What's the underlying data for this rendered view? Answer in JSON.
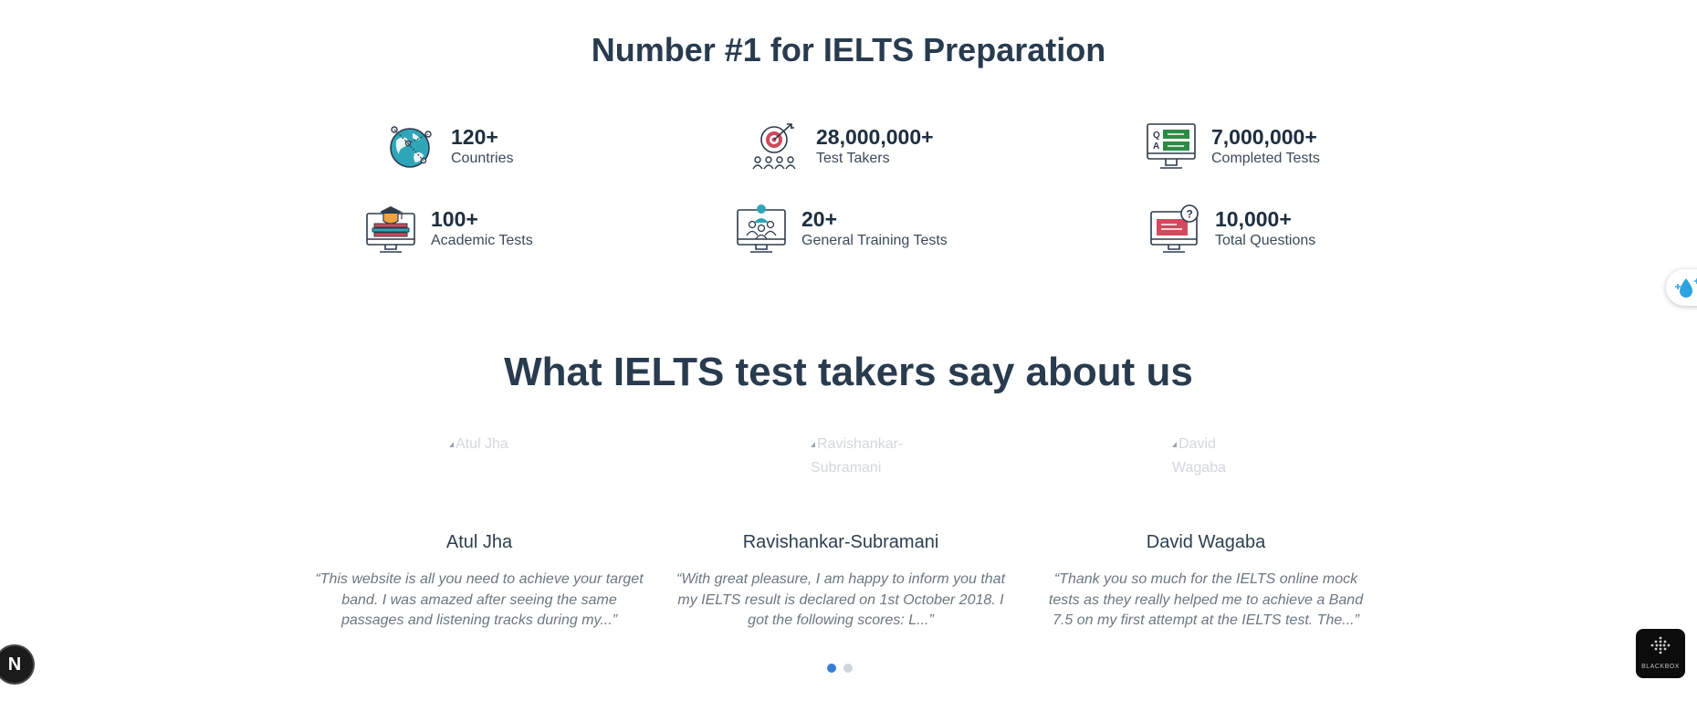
{
  "header": {
    "title": "Number #1 for IELTS Preparation"
  },
  "stats": [
    {
      "number": "120+",
      "label": "Countries",
      "icon": "globe-icon"
    },
    {
      "number": "28,000,000+",
      "label": "Test Takers",
      "icon": "target-people-icon"
    },
    {
      "number": "7,000,000+",
      "label": "Completed Tests",
      "icon": "qa-monitor-icon"
    },
    {
      "number": "100+",
      "label": "Academic Tests",
      "icon": "graduation-monitor-icon"
    },
    {
      "number": "20+",
      "label": "General Training Tests",
      "icon": "team-monitor-icon"
    },
    {
      "number": "10,000+",
      "label": "Total Questions",
      "icon": "question-monitor-icon"
    }
  ],
  "testimonials": {
    "title": "What IELTS test takers say about us",
    "items": [
      {
        "avatar_alt": "Atul Jha",
        "name": "Atul Jha",
        "quote": "“This website is all you need to achieve your target band. I was amazed after seeing the same passages and listening tracks during my...”"
      },
      {
        "avatar_alt": "Ravishankar-Subramani",
        "name": "Ravishankar-Subramani",
        "quote": "“With great pleasure, I am happy to inform you that my IELTS result is declared on 1st October 2018. I got the following scores: L...”"
      },
      {
        "avatar_alt": "David Wagaba",
        "name": "David Wagaba",
        "quote": "“Thank you so much for the IELTS online mock tests as they really helped me to achieve a Band 7.5 on my first attempt at the IELTS test. The...”"
      }
    ],
    "pagination": {
      "pages": 2,
      "active": 1
    }
  },
  "overlays": {
    "next_badge": "N",
    "blackbox_label": "BLACKBOX"
  },
  "colors": {
    "accent": "#3a7bd5",
    "heading": "#283b4f",
    "teal": "#2fa6b8",
    "red": "#d0495c",
    "green": "#2e8b45",
    "orange": "#f0a142"
  }
}
